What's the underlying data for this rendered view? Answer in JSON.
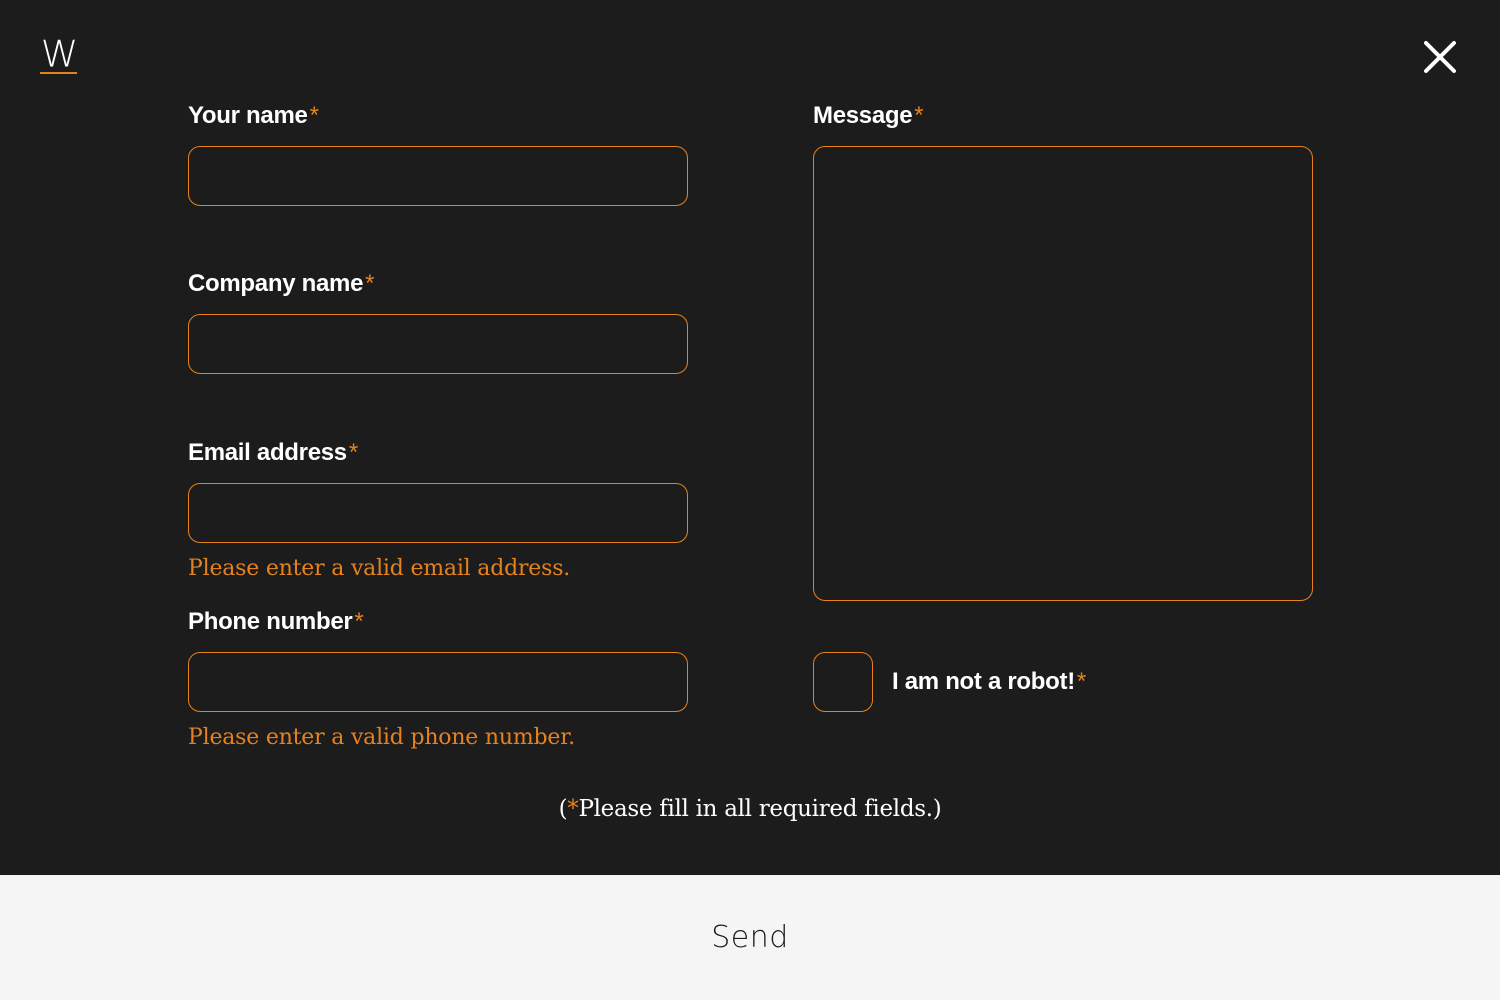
{
  "logo": {
    "letter": "W"
  },
  "form": {
    "required_marker": "*",
    "name": {
      "label": "Your name",
      "value": "",
      "placeholder": ""
    },
    "company": {
      "label": "Company name",
      "value": "",
      "placeholder": ""
    },
    "email": {
      "label": "Email address",
      "value": "",
      "placeholder": "",
      "error": "Please enter a valid email address."
    },
    "phone": {
      "label": "Phone number",
      "value": "",
      "placeholder": "",
      "error": "Please enter a valid phone number."
    },
    "message": {
      "label": "Message",
      "value": "",
      "placeholder": ""
    },
    "robot": {
      "label": "I am not a robot!",
      "checked": false
    }
  },
  "note": {
    "open": "(",
    "star": "*",
    "text": "Please fill in all required fields.)"
  },
  "send": {
    "label": "Send"
  },
  "colors": {
    "background": "#1c1c1c",
    "accent": "#e6821e",
    "footer": "#f5f5f5",
    "text": "#ffffff"
  },
  "icons": {
    "close": "close-icon",
    "logo": "logo-icon"
  }
}
